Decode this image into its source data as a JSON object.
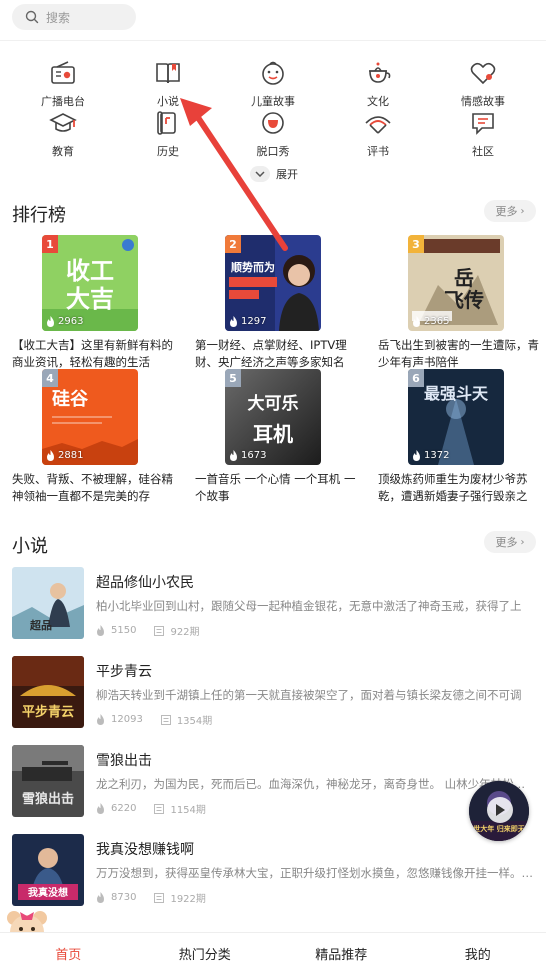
{
  "search": {
    "placeholder": "搜索"
  },
  "categories": [
    {
      "label": "广播电台",
      "icon": "radio-icon"
    },
    {
      "label": "小说",
      "icon": "book-icon"
    },
    {
      "label": "儿童故事",
      "icon": "child-face-icon"
    },
    {
      "label": "文化",
      "icon": "teapot-icon"
    },
    {
      "label": "情感故事",
      "icon": "heart-icon"
    },
    {
      "label": "教育",
      "icon": "graduation-cap-icon"
    },
    {
      "label": "历史",
      "icon": "scroll-icon"
    },
    {
      "label": "脱口秀",
      "icon": "cup-icon"
    },
    {
      "label": "评书",
      "icon": "fan-icon"
    },
    {
      "label": "社区",
      "icon": "chat-icon"
    }
  ],
  "expand_label": "展开",
  "ranking": {
    "title": "排行榜",
    "more": "更多",
    "items": [
      {
        "rank": "1",
        "plays": "2963",
        "desc": "【收工大吉】这里有新鲜有料的商业资讯，轻松有趣的生活",
        "cover_text": "收工大吉",
        "color": "#7ccf5a"
      },
      {
        "rank": "2",
        "plays": "1297",
        "desc": "第一财经、点掌财经、IPTV理财、央广经济之声等多家知名",
        "cover_text": "顺势而为",
        "color": "#2a3a8a"
      },
      {
        "rank": "3",
        "plays": "2365",
        "desc": "岳飞出生到被害的一生遭际，青少年有声书陪伴",
        "cover_text": "岳飞传",
        "color": "#d9cbb0"
      },
      {
        "rank": "4",
        "plays": "2881",
        "desc": "失败、背叛、不被理解，硅谷精神领袖一直都不是完美的存",
        "cover_text": "硅谷",
        "color": "#ef5a1e"
      },
      {
        "rank": "5",
        "plays": "1673",
        "desc": "一首音乐 一个心情 一个耳机 一个故事",
        "cover_text": "大可乐耳机",
        "color": "#3a3a3a"
      },
      {
        "rank": "6",
        "plays": "1372",
        "desc": "顶级炼药师重生为废材少爷苏乾，遭遇新婚妻子强行毁亲之",
        "cover_text": "最强斗天",
        "color": "#1f3550"
      }
    ]
  },
  "novels": {
    "title": "小说",
    "more": "更多",
    "items": [
      {
        "title": "超品修仙小农民",
        "desc": "柏小北毕业回到山村，跟随父母一起种植金银花，无意中激活了神奇玉戒，获得了上",
        "plays": "5150",
        "episodes": "922期",
        "cover_text": "超品修仙小农民"
      },
      {
        "title": "平步青云",
        "desc": "柳浩天转业到千湖镇上任的第一天就直接被架空了，面对着与镇长梁友德之间不可调",
        "plays": "12093",
        "episodes": "1354期",
        "cover_text": "平步青云"
      },
      {
        "title": "雪狼出击",
        "desc": "龙之利刃，为国为民，死而后已。血海深仇，神秘龙牙，离奇身世。 山林少年林松…",
        "plays": "6220",
        "episodes": "1154期",
        "cover_text": "雪狼出击"
      },
      {
        "title": "我真没想赚钱啊",
        "desc": "万万没想到，获得巫皇传承林大宝，正职升级打怪划水摸鱼，忽悠赚钱像开挂一样。…",
        "plays": "8730",
        "episodes": "1922期",
        "cover_text": "我真没想赚钱啊"
      }
    ]
  },
  "float_player_text": "镇世大年 归来即无敌",
  "tabs": [
    {
      "label": "首页",
      "active": true
    },
    {
      "label": "热门分类",
      "active": false
    },
    {
      "label": "精品推荐",
      "active": false
    },
    {
      "label": "我的",
      "active": false
    }
  ],
  "colors": {
    "accent": "#e84a3a",
    "annotation_arrow": "#e8413a"
  }
}
